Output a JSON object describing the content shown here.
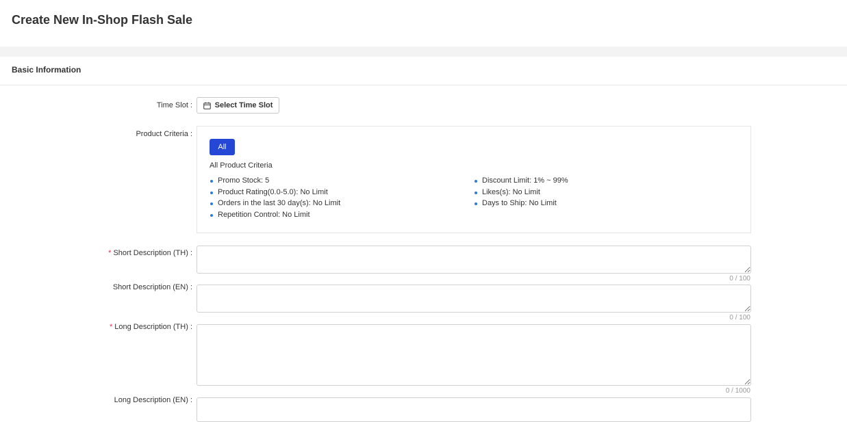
{
  "page": {
    "title": "Create New In-Shop Flash Sale"
  },
  "section": {
    "title": "Basic Information"
  },
  "time_slot": {
    "label": "Time Slot",
    "button_label": "Select Time Slot",
    "icon": "calendar-icon"
  },
  "product_criteria": {
    "label": "Product Criteria",
    "tab_label": "All",
    "heading": "All Product Criteria",
    "left_items": [
      "Promo Stock: 5",
      "Product Rating(0.0-5.0): No Limit",
      "Orders in the last 30 day(s): No Limit",
      "Repetition Control: No Limit"
    ],
    "right_items": [
      "Discount Limit: 1% ~ 99%",
      "Likes(s): No Limit",
      "Days to Ship: No Limit"
    ]
  },
  "fields": {
    "short_desc_th": {
      "label": "Short Description (TH)",
      "required": "*",
      "value": "",
      "counter": "0 / 100"
    },
    "short_desc_en": {
      "label": "Short Description (EN)",
      "value": "",
      "counter": "0 / 100"
    },
    "long_desc_th": {
      "label": "Long Description (TH)",
      "required": "*",
      "value": "",
      "counter": "0 / 1000"
    },
    "long_desc_en": {
      "label": "Long Description (EN)",
      "value": ""
    }
  },
  "label_separator": ":",
  "colors": {
    "primary": "#2447d6",
    "bullet": "#2a7ae2",
    "required": "#ee2c4a",
    "background_strip": "#f3f3f3"
  }
}
